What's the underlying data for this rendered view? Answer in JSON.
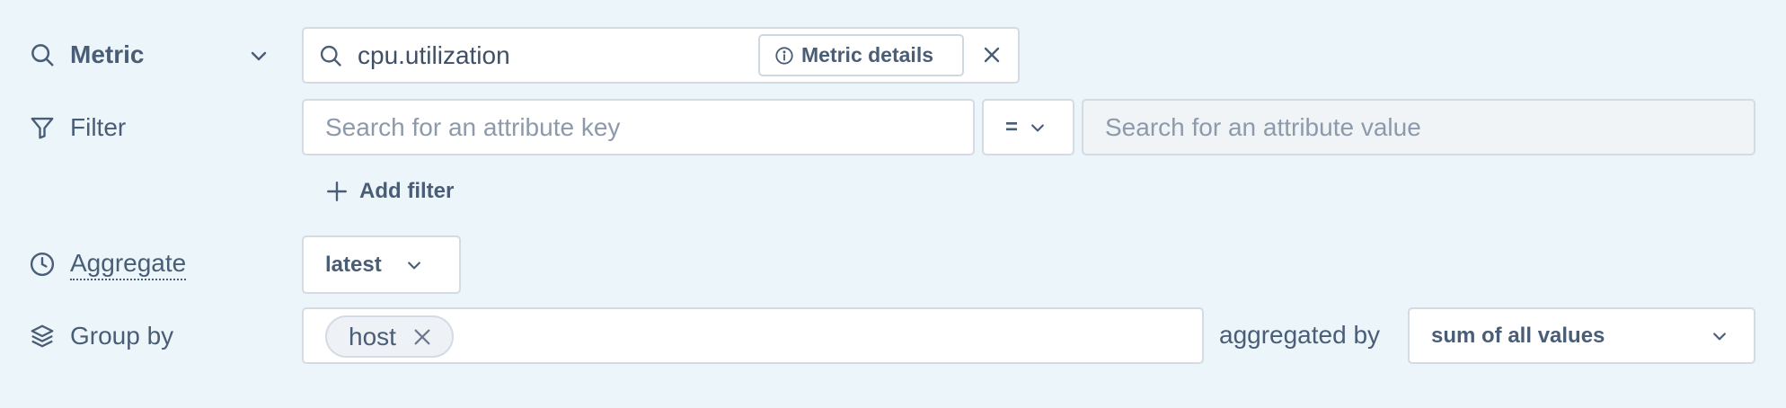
{
  "rows": {
    "metric": {
      "label": "Metric",
      "value": "cpu.utilization",
      "details_button": "Metric details"
    },
    "filter": {
      "label": "Filter",
      "key_placeholder": "Search for an attribute key",
      "operator": "=",
      "value_placeholder": "Search for an attribute value",
      "add_label": "Add filter"
    },
    "aggregate": {
      "label": "Aggregate",
      "value": "latest"
    },
    "group_by": {
      "label": "Group by",
      "tags": [
        "host"
      ],
      "aggregated_by_label": "aggregated by",
      "aggregated_by_value": "sum of all values"
    }
  },
  "icons": {
    "metric": "search-icon",
    "filter": "filter-icon",
    "aggregate": "clock-icon",
    "group_by": "layers-icon"
  },
  "colors": {
    "background": "#ebf5fa",
    "text": "#4a5d77",
    "placeholder": "#8d9aab",
    "border": "#d4dbe4",
    "disabled_field": "#f1f4f7"
  }
}
